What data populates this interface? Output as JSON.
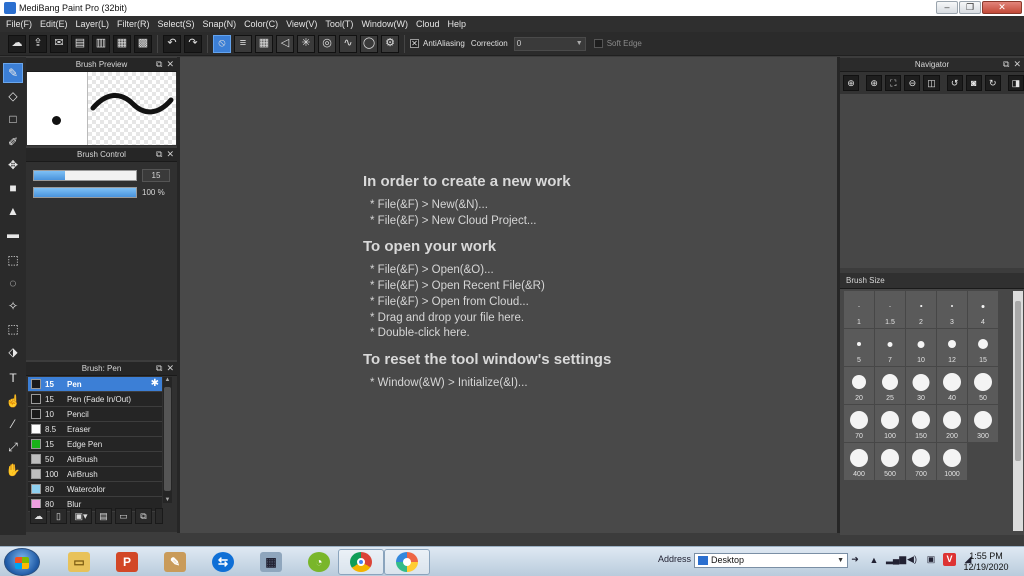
{
  "window": {
    "title": "MediBang Paint Pro (32bit)",
    "buttons": [
      "–",
      "❐",
      "✕"
    ]
  },
  "menu": [
    "File(F)",
    "Edit(E)",
    "Layer(L)",
    "Filter(R)",
    "Select(S)",
    "Snap(N)",
    "Color(C)",
    "View(V)",
    "Tool(T)",
    "Window(W)",
    "Cloud",
    "Help"
  ],
  "toolbar": {
    "antialiasing_label": "AntiAliasing",
    "antialiasing_checked": true,
    "correction_label": "Correction",
    "correction_value": "0",
    "soft_edge_label": "Soft Edge",
    "soft_edge_checked": false
  },
  "panels": {
    "brush_preview": {
      "title": "Brush Preview"
    },
    "brush_control": {
      "title": "Brush Control",
      "size_value": "15",
      "size_fill": 0.3,
      "opacity_value": "100 %",
      "opacity_fill": 1.0
    },
    "brush_list": {
      "title": "Brush: Pen",
      "items": [
        {
          "size": "15",
          "name": "Pen",
          "color": "#1a1a1a",
          "selected": true
        },
        {
          "size": "15",
          "name": "Pen (Fade In/Out)",
          "color": "#1a1a1a",
          "selected": false
        },
        {
          "size": "10",
          "name": "Pencil",
          "color": "#1a1a1a",
          "selected": false
        },
        {
          "size": "8.5",
          "name": "Eraser",
          "color": "#ffffff",
          "selected": false
        },
        {
          "size": "15",
          "name": "Edge Pen",
          "color": "#19b319",
          "selected": false
        },
        {
          "size": "50",
          "name": "AirBrush",
          "color": "#bdbdbd",
          "selected": false
        },
        {
          "size": "100",
          "name": "AirBrush",
          "color": "#bdbdbd",
          "selected": false
        },
        {
          "size": "80",
          "name": "Watercolor",
          "color": "#8fd0f0",
          "selected": false
        },
        {
          "size": "80",
          "name": "Blur",
          "color": "#f0a0e0",
          "selected": false
        }
      ]
    },
    "navigator": {
      "title": "Navigator"
    },
    "brush_size": {
      "title": "Brush Size",
      "sizes": [
        {
          "label": "1",
          "dot": 1
        },
        {
          "label": "1.5",
          "dot": 1
        },
        {
          "label": "2",
          "dot": 1.5
        },
        {
          "label": "3",
          "dot": 2
        },
        {
          "label": "4",
          "dot": 3
        },
        {
          "label": "5",
          "dot": 4
        },
        {
          "label": "7",
          "dot": 5
        },
        {
          "label": "10",
          "dot": 7
        },
        {
          "label": "12",
          "dot": 8
        },
        {
          "label": "15",
          "dot": 10
        },
        {
          "label": "20",
          "dot": 14
        },
        {
          "label": "25",
          "dot": 16
        },
        {
          "label": "30",
          "dot": 17
        },
        {
          "label": "40",
          "dot": 18
        },
        {
          "label": "50",
          "dot": 18
        },
        {
          "label": "70",
          "dot": 18
        },
        {
          "label": "100",
          "dot": 18
        },
        {
          "label": "150",
          "dot": 18
        },
        {
          "label": "200",
          "dot": 18
        },
        {
          "label": "300",
          "dot": 18
        },
        {
          "label": "400",
          "dot": 18
        },
        {
          "label": "500",
          "dot": 18
        },
        {
          "label": "700",
          "dot": 18
        },
        {
          "label": "1000",
          "dot": 18
        }
      ]
    }
  },
  "welcome": {
    "sections": [
      {
        "heading": "In order to create a new work",
        "items": [
          "* File(&F) > New(&N)...",
          "* File(&F) > New Cloud Project..."
        ]
      },
      {
        "heading": "To open your work",
        "items": [
          "* File(&F) > Open(&O)...",
          "* File(&F) > Open Recent File(&R)",
          "* File(&F) > Open from Cloud...",
          "* Drag and drop your file here.",
          "* Double-click here."
        ]
      },
      {
        "heading": "To reset the tool window's settings",
        "items": [
          "* Window(&W) > Initialize(&I)..."
        ]
      }
    ]
  },
  "taskbar": {
    "address_label": "Address",
    "address_value": "Desktop",
    "time": "1:55 PM",
    "date": "12/19/2020"
  }
}
